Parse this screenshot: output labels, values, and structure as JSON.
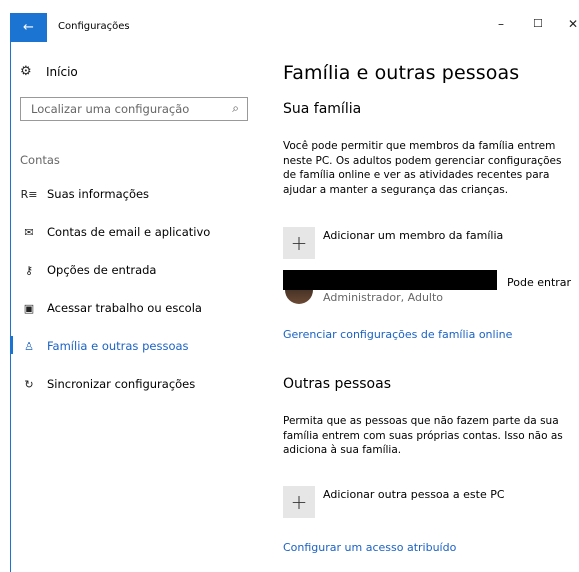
{
  "window": {
    "title": "Configurações",
    "back_symbol": "←",
    "minimize_symbol": "–",
    "maximize_symbol": "☐",
    "close_symbol": "✕"
  },
  "sidebar": {
    "home_label": "Início",
    "search_placeholder": "Localizar uma configuração",
    "section_label": "Contas",
    "items": [
      {
        "label": "Suas informações",
        "icon": "person-list-icon"
      },
      {
        "label": "Contas de email e aplicativo",
        "icon": "mail-icon"
      },
      {
        "label": "Opções de entrada",
        "icon": "key-icon"
      },
      {
        "label": "Acessar trabalho ou escola",
        "icon": "briefcase-icon"
      },
      {
        "label": "Família e outras pessoas",
        "icon": "person-icon",
        "active": true
      },
      {
        "label": "Sincronizar configurações",
        "icon": "sync-icon"
      }
    ]
  },
  "main": {
    "title": "Família e outras pessoas",
    "family": {
      "heading": "Sua família",
      "description": "Você pode permitir que membros da família entrem neste PC. Os adultos podem gerenciar configurações de família online e ver as atividades recentes para ajudar a manter a segurança das crianças.",
      "add_label": "Adicionar um membro da família",
      "member_status": "Pode entrar",
      "member_role": "Administrador, Adulto",
      "manage_link": "Gerenciar configurações de família online"
    },
    "others": {
      "heading": "Outras pessoas",
      "description": "Permita que as pessoas que não fazem parte da sua família entrem com suas próprias contas. Isso não as adiciona à sua família.",
      "add_label": "Adicionar outra pessoa a este PC",
      "assigned_access_link": "Configurar um acesso atribuído"
    }
  },
  "colors": {
    "accent": "#1b73d2",
    "link": "#1b62c4",
    "tile": "#e6e6e6"
  }
}
